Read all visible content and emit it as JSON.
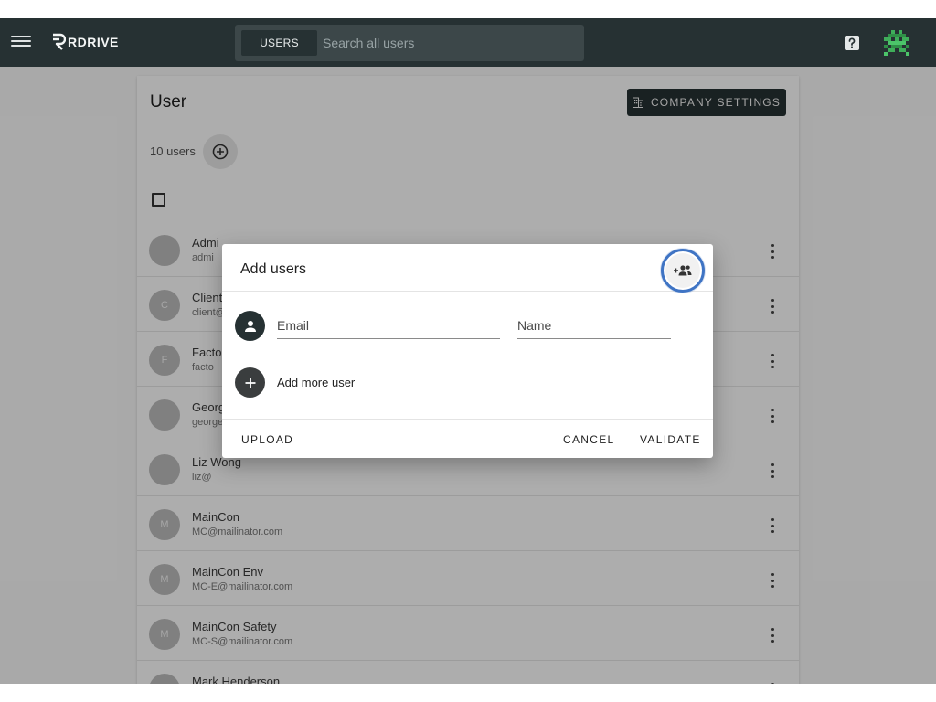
{
  "app": {
    "logo_text": "RDRIVE"
  },
  "search": {
    "tab_label": "USERS",
    "placeholder": "Search all users"
  },
  "header": {
    "help_icon": "help-icon",
    "avatar_icon": "pixel-avatar-icon"
  },
  "page": {
    "title": "User",
    "company_settings_label": "COMPANY SETTINGS",
    "users_count": "10 users"
  },
  "users": [
    {
      "initial": "",
      "name": "Admi",
      "email": "admi"
    },
    {
      "initial": "C",
      "name": "Client",
      "email": "client@"
    },
    {
      "initial": "F",
      "name": "Facto",
      "email": "facto"
    },
    {
      "initial": "",
      "name": "Georg",
      "email": "george"
    },
    {
      "initial": "",
      "name": "Liz Wong",
      "email": "liz@"
    },
    {
      "initial": "M",
      "name": "MainCon",
      "email": "MC@mailinator.com"
    },
    {
      "initial": "M",
      "name": "MainCon Env",
      "email": "MC-E@mailinator.com"
    },
    {
      "initial": "M",
      "name": "MainCon Safety",
      "email": "MC-S@mailinator.com"
    },
    {
      "initial": "",
      "name": "Mark Henderson",
      "email": ""
    }
  ],
  "dialog": {
    "title": "Add users",
    "email_placeholder": "Email",
    "name_placeholder": "Name",
    "add_more_label": "Add more user",
    "upload_label": "UPLOAD",
    "cancel_label": "CANCEL",
    "validate_label": "VALIDATE"
  },
  "colors": {
    "topbar": "#263133",
    "accent_ring": "#3f74c4"
  }
}
